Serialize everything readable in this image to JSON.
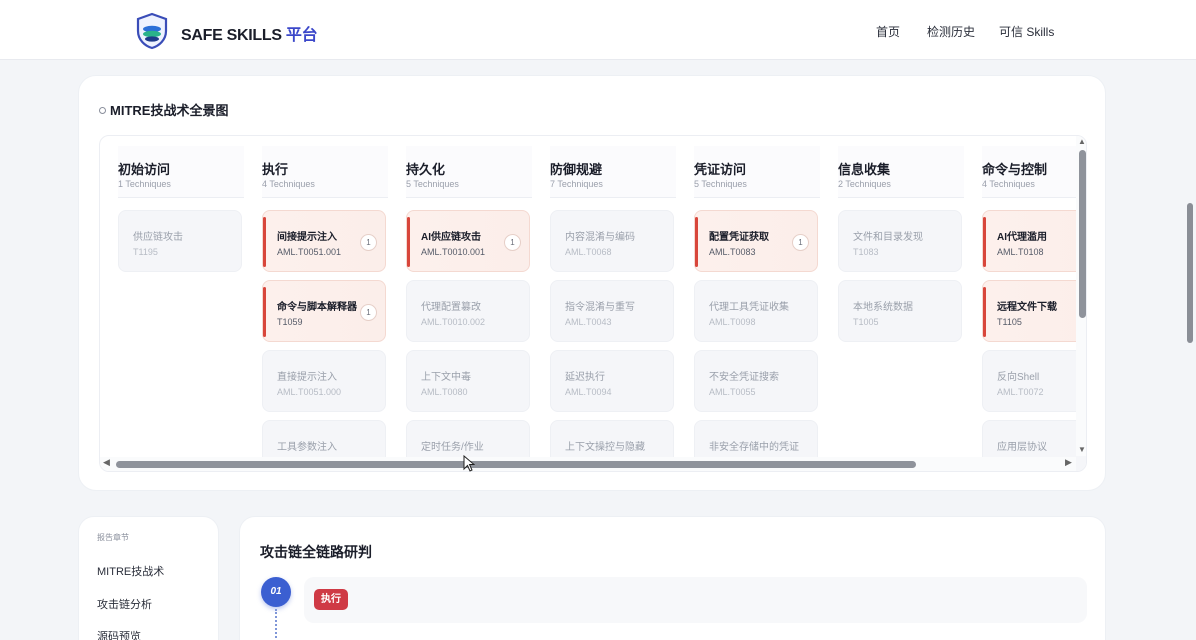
{
  "header": {
    "brand_main": "SAFE SKILLS",
    "brand_accent": "平台",
    "nav": {
      "home": "首页",
      "history": "检测历史",
      "skills": "可信 Skills"
    }
  },
  "mitre": {
    "title": "MITRE技战术全景图",
    "columns": [
      {
        "name": "初始访问",
        "count": "1 Techniques",
        "items": [
          {
            "name": "供应链攻击",
            "id": "T1195",
            "hot": false
          }
        ]
      },
      {
        "name": "执行",
        "count": "4 Techniques",
        "items": [
          {
            "name": "间接提示注入",
            "id": "AML.T0051.001",
            "hot": true,
            "badge": "1"
          },
          {
            "name": "命令与脚本解释器",
            "id": "T1059",
            "hot": true,
            "badge": "1"
          },
          {
            "name": "直接提示注入",
            "id": "AML.T0051.000",
            "hot": false
          },
          {
            "name": "工具参数注入",
            "id": "",
            "hot": false
          }
        ]
      },
      {
        "name": "持久化",
        "count": "5 Techniques",
        "items": [
          {
            "name": "AI供应链攻击",
            "id": "AML.T0010.001",
            "hot": true,
            "badge": "1"
          },
          {
            "name": "代理配置篡改",
            "id": "AML.T0010.002",
            "hot": false
          },
          {
            "name": "上下文中毒",
            "id": "AML.T0080",
            "hot": false
          },
          {
            "name": "定时任务/作业",
            "id": "",
            "hot": false
          }
        ]
      },
      {
        "name": "防御规避",
        "count": "7 Techniques",
        "items": [
          {
            "name": "内容混淆与编码",
            "id": "AML.T0068",
            "hot": false
          },
          {
            "name": "指令混淆与重写",
            "id": "AML.T0043",
            "hot": false
          },
          {
            "name": "延迟执行",
            "id": "AML.T0094",
            "hot": false
          },
          {
            "name": "上下文操控与隐藏",
            "id": "",
            "hot": false
          }
        ]
      },
      {
        "name": "凭证访问",
        "count": "5 Techniques",
        "items": [
          {
            "name": "配置凭证获取",
            "id": "AML.T0083",
            "hot": true,
            "badge": "1"
          },
          {
            "name": "代理工具凭证收集",
            "id": "AML.T0098",
            "hot": false
          },
          {
            "name": "不安全凭证搜索",
            "id": "AML.T0055",
            "hot": false
          },
          {
            "name": "非安全存储中的凭证",
            "id": "",
            "hot": false
          }
        ]
      },
      {
        "name": "信息收集",
        "count": "2 Techniques",
        "items": [
          {
            "name": "文件和目录发现",
            "id": "T1083",
            "hot": false
          },
          {
            "name": "本地系统数据",
            "id": "T1005",
            "hot": false
          }
        ]
      },
      {
        "name": "命令与控制",
        "count": "4 Techniques",
        "items": [
          {
            "name": "AI代理滥用",
            "id": "AML.T0108",
            "hot": true
          },
          {
            "name": "远程文件下载",
            "id": "T1105",
            "hot": true
          },
          {
            "name": "反向Shell",
            "id": "AML.T0072",
            "hot": false
          },
          {
            "name": "应用层协议",
            "id": "",
            "hot": false
          }
        ]
      }
    ]
  },
  "sidebar": {
    "heading": "报告章节",
    "items": [
      "MITRE技战术",
      "攻击链分析",
      "源码预览"
    ]
  },
  "chain": {
    "title": "攻击链全链路研判",
    "step_number": "01",
    "step_tag": "执行"
  },
  "colors": {
    "accent": "#3b47c9",
    "danger": "#d8463b",
    "step": "#3b5fd1"
  }
}
